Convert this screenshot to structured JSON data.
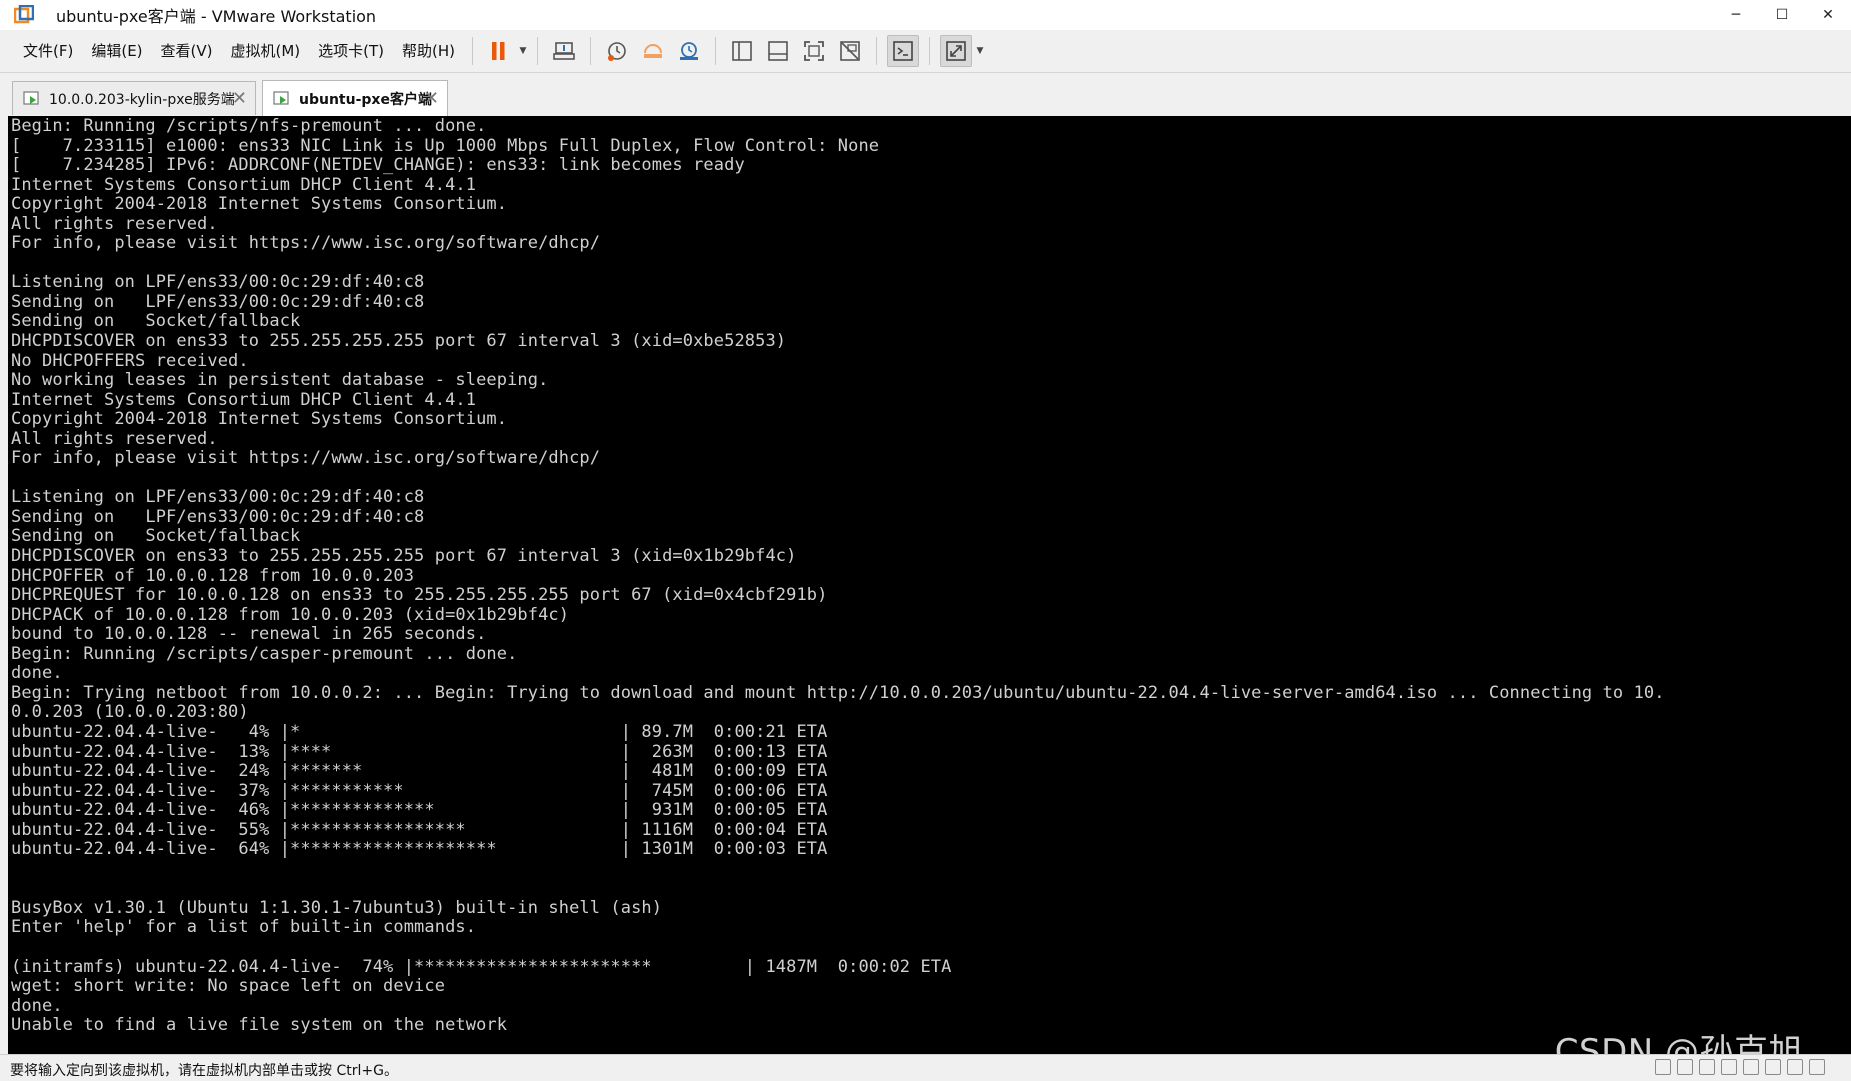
{
  "window": {
    "title": "ubuntu-pxe客户端 - VMware Workstation",
    "controls": {
      "minimize": "─",
      "maximize": "☐",
      "close": "✕"
    }
  },
  "menu": [
    "文件(F)",
    "编辑(E)",
    "查看(V)",
    "虚拟机(M)",
    "选项卡(T)",
    "帮助(H)"
  ],
  "toolbar_icons": [
    "pause-icon",
    "send-ctrl-alt-del-icon",
    "snapshot-icon",
    "revert-snapshot-icon",
    "snapshot-manager-icon",
    "library-icon",
    "thumbnail-bar-icon",
    "fullscreen-icon",
    "unity-icon",
    "console-view-icon",
    "stretch-view-icon"
  ],
  "tabs": [
    {
      "label": "10.0.0.203-kylin-pxe服务端",
      "active": false
    },
    {
      "label": "ubuntu-pxe客户端",
      "active": true
    }
  ],
  "console": {
    "lines": [
      "Begin: Running /scripts/nfs-premount ... done.",
      "[    7.233115] e1000: ens33 NIC Link is Up 1000 Mbps Full Duplex, Flow Control: None",
      "[    7.234285] IPv6: ADDRCONF(NETDEV_CHANGE): ens33: link becomes ready",
      "Internet Systems Consortium DHCP Client 4.4.1",
      "Copyright 2004-2018 Internet Systems Consortium.",
      "All rights reserved.",
      "For info, please visit https://www.isc.org/software/dhcp/",
      "",
      "Listening on LPF/ens33/00:0c:29:df:40:c8",
      "Sending on   LPF/ens33/00:0c:29:df:40:c8",
      "Sending on   Socket/fallback",
      "DHCPDISCOVER on ens33 to 255.255.255.255 port 67 interval 3 (xid=0xbe52853)",
      "No DHCPOFFERS received.",
      "No working leases in persistent database - sleeping.",
      "Internet Systems Consortium DHCP Client 4.4.1",
      "Copyright 2004-2018 Internet Systems Consortium.",
      "All rights reserved.",
      "For info, please visit https://www.isc.org/software/dhcp/",
      "",
      "Listening on LPF/ens33/00:0c:29:df:40:c8",
      "Sending on   LPF/ens33/00:0c:29:df:40:c8",
      "Sending on   Socket/fallback",
      "DHCPDISCOVER on ens33 to 255.255.255.255 port 67 interval 3 (xid=0x1b29bf4c)",
      "DHCPOFFER of 10.0.0.128 from 10.0.0.203",
      "DHCPREQUEST for 10.0.0.128 on ens33 to 255.255.255.255 port 67 (xid=0x4cbf291b)",
      "DHCPACK of 10.0.0.128 from 10.0.0.203 (xid=0x1b29bf4c)",
      "bound to 10.0.0.128 -- renewal in 265 seconds.",
      "Begin: Running /scripts/casper-premount ... done.",
      "done.",
      "Begin: Trying netboot from 10.0.0.2: ... Begin: Trying to download and mount http://10.0.0.203/ubuntu/ubuntu-22.04.4-live-server-amd64.iso ... Connecting to 10.",
      "0.0.203 (10.0.0.203:80)",
      "ubuntu-22.04.4-live-   4% |*                               | 89.7M  0:00:21 ETA",
      "ubuntu-22.04.4-live-  13% |****                            |  263M  0:00:13 ETA",
      "ubuntu-22.04.4-live-  24% |*******                         |  481M  0:00:09 ETA",
      "ubuntu-22.04.4-live-  37% |***********                     |  745M  0:00:06 ETA",
      "ubuntu-22.04.4-live-  46% |**************                  |  931M  0:00:05 ETA",
      "ubuntu-22.04.4-live-  55% |*****************               | 1116M  0:00:04 ETA",
      "ubuntu-22.04.4-live-  64% |********************            | 1301M  0:00:03 ETA",
      "",
      "",
      "BusyBox v1.30.1 (Ubuntu 1:1.30.1-7ubuntu3) built-in shell (ash)",
      "Enter 'help' for a list of built-in commands.",
      "",
      "(initramfs) ubuntu-22.04.4-live-  74% |***********************         | 1487M  0:00:02 ETA",
      "wget: short write: No space left on device",
      "done.",
      "Unable to find a live file system on the network"
    ]
  },
  "statusbar": {
    "text": "要将输入定向到该虚拟机，请在虚拟机内部单击或按 Ctrl+G。",
    "icons": [
      "hdd-icon",
      "cd-icon",
      "network-icon",
      "sound-icon",
      "usb-icon",
      "printer-icon",
      "display-icon",
      "message-icon"
    ]
  },
  "watermark": "CSDN @孙克旭",
  "colors": {
    "accent": "#e8590c",
    "console_bg": "#000000",
    "console_fg": "#d0d0d0"
  }
}
